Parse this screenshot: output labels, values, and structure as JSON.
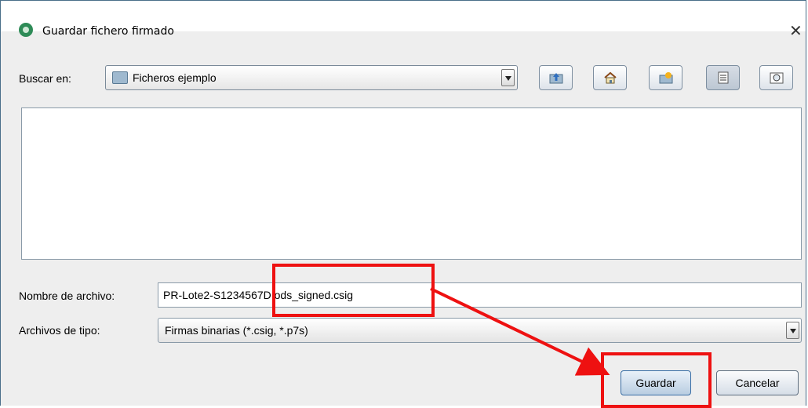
{
  "window": {
    "title": "Guardar fichero firmado",
    "close_icon": "close-icon"
  },
  "look_in": {
    "label": "Buscar en:",
    "value": "Ficheros ejemplo"
  },
  "toolbar": [
    {
      "name": "up-folder-icon"
    },
    {
      "name": "home-icon"
    },
    {
      "name": "new-folder-icon"
    },
    {
      "name": "list-view-icon",
      "selected": true
    },
    {
      "name": "details-view-icon"
    }
  ],
  "filename": {
    "label": "Nombre de archivo:",
    "value": "PR-Lote2-S1234567D.ods_signed.csig"
  },
  "filetype": {
    "label": "Archivos de tipo:",
    "value": "Firmas binarias (*.csig, *.p7s)"
  },
  "buttons": {
    "save": "Guardar",
    "cancel": "Cancelar"
  },
  "colors": {
    "highlight": "#ee1111",
    "accent": "#3a6ea5",
    "frame": "#4a6f8a"
  }
}
